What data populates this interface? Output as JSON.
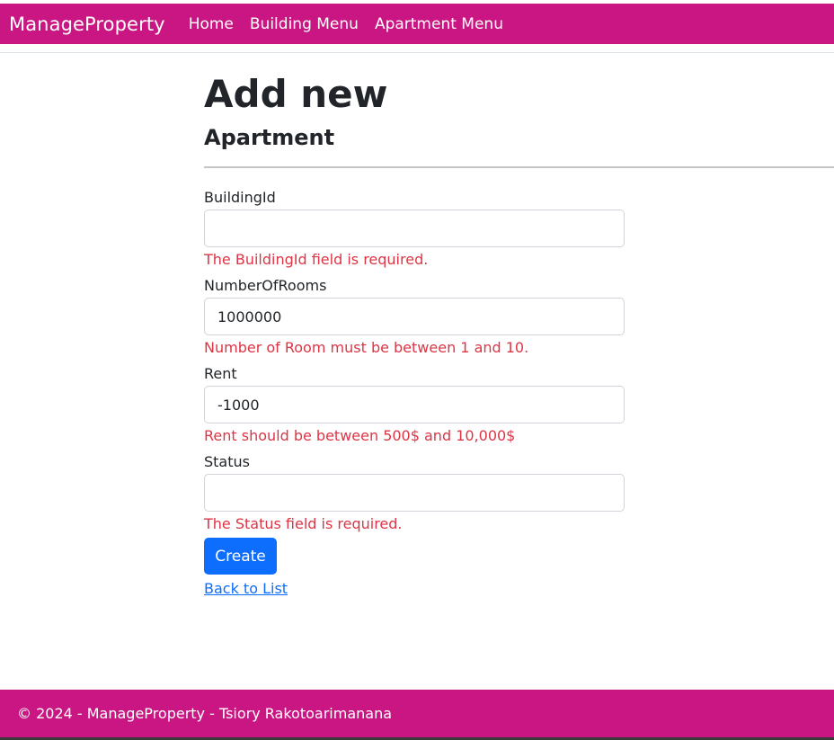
{
  "navbar": {
    "brand": "ManageProperty",
    "links": [
      "Home",
      "Building Menu",
      "Apartment Menu"
    ]
  },
  "page": {
    "title": "Add new",
    "subtitle": "Apartment"
  },
  "form": {
    "fields": [
      {
        "label": "BuildingId",
        "value": "",
        "error": "The BuildingId field is required."
      },
      {
        "label": "NumberOfRooms",
        "value": "1000000",
        "error": "Number of Room must be between 1 and 10."
      },
      {
        "label": "Rent",
        "value": "-1000",
        "error": "Rent should be between 500$ and 10,000$"
      },
      {
        "label": "Status",
        "value": "",
        "error": "The Status field is required."
      }
    ],
    "submit_label": "Create",
    "back_link": "Back to List"
  },
  "footer": {
    "text": "© 2024 - ManageProperty - Tsiory Rakotoarimanana"
  },
  "colors": {
    "brand": "#c91682",
    "error": "#dc3545",
    "primary": "#0d6efd"
  }
}
